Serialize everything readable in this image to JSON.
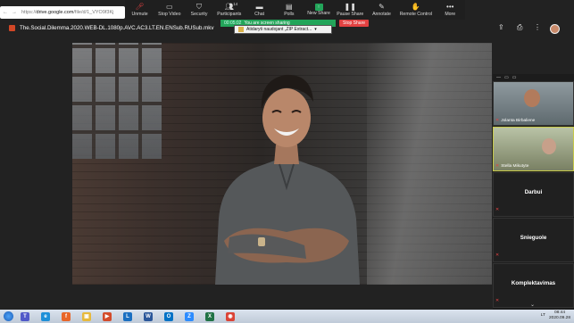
{
  "browser": {
    "url_prefix": "https://",
    "url_domain": "drive.google.com",
    "url_path": "/file/d/1_VYO9f3Kj",
    "nav": [
      "←",
      "→",
      "⟳"
    ]
  },
  "toolbar": {
    "items": [
      {
        "label": "Unmute",
        "icon": "mic-muted-icon",
        "glyph": "🎤︎"
      },
      {
        "label": "Stop Video",
        "icon": "video-icon",
        "glyph": "▭"
      },
      {
        "label": "Security",
        "icon": "shield-icon",
        "glyph": "⛉"
      },
      {
        "label": "Participants",
        "icon": "participants-icon",
        "glyph": "👥︎",
        "count": "14"
      },
      {
        "label": "Chat",
        "icon": "chat-icon",
        "glyph": "▬"
      },
      {
        "label": "Polls",
        "icon": "polls-icon",
        "glyph": "▤"
      },
      {
        "label": "New Share",
        "icon": "new-share-icon",
        "glyph": "↑"
      },
      {
        "label": "Pause Share",
        "icon": "pause-icon",
        "glyph": "❚❚"
      },
      {
        "label": "Annotate",
        "icon": "annotate-icon",
        "glyph": "✎"
      },
      {
        "label": "Remote Control",
        "icon": "remote-control-icon",
        "glyph": "✋"
      },
      {
        "label": "More",
        "icon": "more-icon",
        "glyph": "•••"
      }
    ]
  },
  "share_banner": {
    "timer": "00:05:02",
    "text": "You are screen sharing",
    "stop_label": "Stop Share"
  },
  "zip_popup": {
    "text": "Atidaryti naudojant „ZIP Extract...",
    "menu_glyph": "▾"
  },
  "title": {
    "filename": "The.Social.Dilemma.2020.WEB-DL.1080p.AVC.AC3.LT.EN.ENSub.RUSub.mkv",
    "icons": [
      "add-to-drive-icon",
      "print-icon",
      "more-vert-icon"
    ]
  },
  "participants": [
    {
      "name": "Jolanta Birbaliene",
      "has_video": true,
      "muted": true
    },
    {
      "name": "Stella Mikutyte",
      "has_video": true,
      "muted": true
    },
    {
      "name": "Darbui",
      "has_video": false,
      "muted": true
    },
    {
      "name": "Snieguole",
      "has_video": false,
      "muted": true
    },
    {
      "name": "Komplektavimas",
      "has_video": false,
      "muted": true
    }
  ],
  "panel_controls": [
    "—",
    "▭",
    "▭"
  ],
  "taskbar": {
    "apps": [
      {
        "name": "teams-icon",
        "color": "#5059c9",
        "glyph": "T"
      },
      {
        "name": "ie-icon",
        "color": "#1e90d8",
        "glyph": "e"
      },
      {
        "name": "firefox-icon",
        "color": "#e8662a",
        "glyph": "f"
      },
      {
        "name": "explorer-icon",
        "color": "#e7b93c",
        "glyph": "▣"
      },
      {
        "name": "media-icon",
        "color": "#d34b2b",
        "glyph": "▶"
      },
      {
        "name": "lync-icon",
        "color": "#1a6fc1",
        "glyph": "L"
      },
      {
        "name": "word-icon",
        "color": "#2b579a",
        "glyph": "W"
      },
      {
        "name": "outlook-icon",
        "color": "#0072c6",
        "glyph": "O"
      },
      {
        "name": "zoom-icon",
        "color": "#2d8cff",
        "glyph": "Z"
      },
      {
        "name": "excel-icon",
        "color": "#217346",
        "glyph": "X"
      },
      {
        "name": "chrome-icon",
        "color": "#db4437",
        "glyph": "◉"
      }
    ],
    "language": "LT",
    "time": "08:44",
    "date": "2020.09.28"
  }
}
